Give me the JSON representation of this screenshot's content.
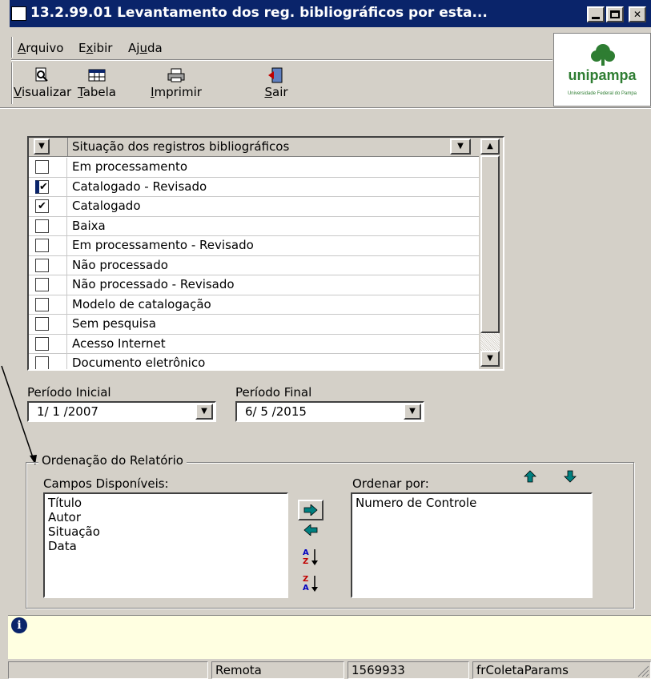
{
  "window": {
    "title": "13.2.99.01 Levantamento dos reg. bibliográficos por esta...",
    "controls": [
      "minimize",
      "maximize",
      "close"
    ]
  },
  "menu": {
    "items": [
      {
        "label": "Arquivo",
        "mnemonic": "A"
      },
      {
        "label": "Exibir",
        "mnemonic": "x"
      },
      {
        "label": "Ajuda",
        "mnemonic": "u"
      }
    ]
  },
  "toolbar": {
    "buttons": [
      {
        "label": "Visualizar",
        "icon": "preview-icon"
      },
      {
        "label": "Tabela",
        "icon": "table-icon"
      },
      {
        "label": "Imprimir",
        "icon": "printer-icon"
      },
      {
        "label": "Sair",
        "icon": "exit-door-icon"
      }
    ]
  },
  "logo": {
    "name": "unipampa",
    "subtitle": "Universidade Federal do Pampa",
    "color": "#2e7d32"
  },
  "situacao": {
    "header": "Situação dos registros bibliográficos",
    "rows": [
      {
        "label": "Em processamento",
        "checked": false,
        "selected": false
      },
      {
        "label": "Catalogado - Revisado",
        "checked": true,
        "selected": true
      },
      {
        "label": "Catalogado",
        "checked": true,
        "selected": false
      },
      {
        "label": "Baixa",
        "checked": false,
        "selected": false
      },
      {
        "label": "Em processamento - Revisado",
        "checked": false,
        "selected": false
      },
      {
        "label": "Não processado",
        "checked": false,
        "selected": false
      },
      {
        "label": "Não processado - Revisado",
        "checked": false,
        "selected": false
      },
      {
        "label": "Modelo de catalogação",
        "checked": false,
        "selected": false
      },
      {
        "label": "Sem pesquisa",
        "checked": false,
        "selected": false
      },
      {
        "label": "Acesso Internet",
        "checked": false,
        "selected": false
      },
      {
        "label": "Documento eletrônico",
        "checked": false,
        "selected": false
      }
    ]
  },
  "periodo": {
    "inicial_label": "Período Inicial",
    "inicial_value": "1/ 1 /2007",
    "final_label": "Período Final",
    "final_value": "6/ 5 /2015"
  },
  "ordenacao": {
    "title": "Ordenação do Relatório",
    "disponiveis_label": "Campos Disponíveis:",
    "disponiveis": [
      "Título",
      "Autor",
      "Situação",
      "Data"
    ],
    "ordenar_label": "Ordenar por:",
    "ordenar": [
      "Numero de Controle"
    ],
    "accent": "#008080"
  },
  "status": {
    "panels": [
      "",
      "Remota",
      "1569933",
      "frColetaParams"
    ]
  }
}
